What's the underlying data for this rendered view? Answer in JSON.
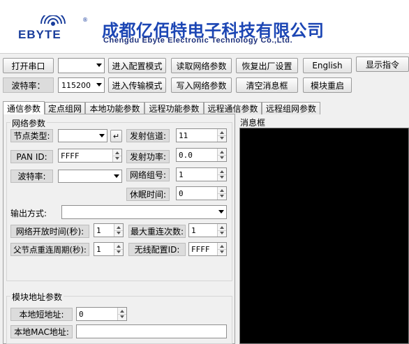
{
  "header": {
    "logo_text": "EBYTE",
    "company_cn": "成都亿佰特电子科技有限公司",
    "company_en": "Chengdu Ebyte Electronic Technology Co.,Ltd."
  },
  "toolbar": {
    "open_port": "打开串口",
    "port_select": "",
    "enter_config": "进入配置模式",
    "read_params": "读取网络参数",
    "factory_reset": "恢复出厂设置",
    "language": "English",
    "show_cmd": "显示指令",
    "baud_label": "波特率：",
    "baud_value": "115200",
    "enter_transfer": "进入传输模式",
    "write_params": "写入网络参数",
    "clear_msg": "清空消息框",
    "module_restart": "模块重启"
  },
  "tabs": [
    "通信参数",
    "定点组网",
    "本地功能参数",
    "远程功能参数",
    "远程通信参数",
    "远程组网参数"
  ],
  "network": {
    "title": "网络参数",
    "node_type_label": "节点类型:",
    "node_type_value": "",
    "pan_id_label": "PAN  ID:",
    "pan_id_value": "FFFF",
    "baud_label": "波特率:",
    "baud_value": "",
    "tx_channel_label": "发射信道:",
    "tx_channel_value": "11",
    "tx_power_label": "发射功率:",
    "tx_power_value": "0.0",
    "group_label": "网络组号:",
    "group_value": "1",
    "sleep_label": "休眠时间:",
    "sleep_value": "0",
    "output_label": "输出方式:",
    "output_value": "",
    "open_time_label": "网络开放时间(秒):",
    "open_time_value": "1",
    "max_retry_label": "最大重连次数:",
    "max_retry_value": "1",
    "parent_retry_label": "父节点重连周期(秒):",
    "parent_retry_value": "1",
    "wireless_id_label": "无线配置ID:",
    "wireless_id_value": "FFFF"
  },
  "address": {
    "title": "模块地址参数",
    "short_addr_label": "本地短地址:",
    "short_addr_value": "0",
    "mac_label": "本地MAC地址:",
    "mac_value": ""
  },
  "message": {
    "title": "消息框"
  },
  "colors": {
    "brand_blue": "#1c46b4",
    "message_bg": "#000000",
    "panel_bg": "#f0f0f0"
  }
}
